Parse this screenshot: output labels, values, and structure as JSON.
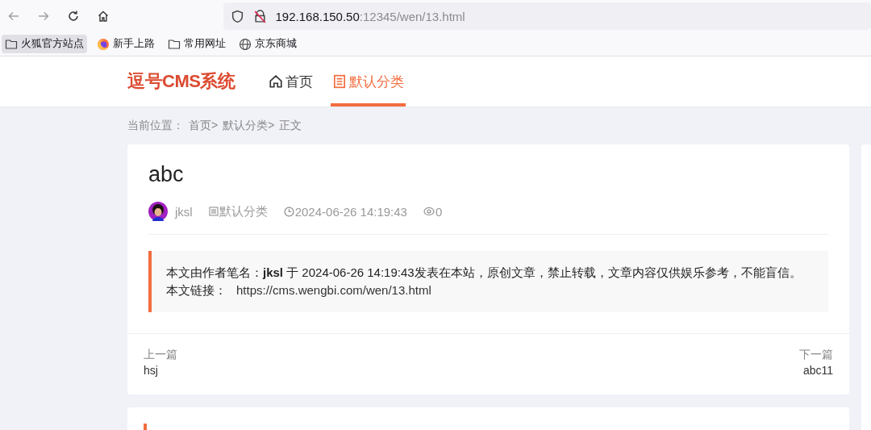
{
  "browser": {
    "url_host": "192.168.150.50",
    "url_rest": ":12345/wen/13.html",
    "bookmarks": [
      {
        "label": "火狐官方站点",
        "kind": "folder",
        "selected": true
      },
      {
        "label": "新手上路",
        "kind": "firefox",
        "selected": false
      },
      {
        "label": "常用网址",
        "kind": "folder",
        "selected": false
      },
      {
        "label": "京东商城",
        "kind": "globe",
        "selected": false
      }
    ]
  },
  "header": {
    "logo": "逗号CMS系统",
    "nav": [
      {
        "label": "首页",
        "kind": "home",
        "selected": false
      },
      {
        "label": "默认分类",
        "kind": "doc",
        "selected": true
      }
    ]
  },
  "breadcrumb": {
    "label": "当前位置：",
    "items": [
      "首页>",
      "默认分类>",
      "正文"
    ]
  },
  "article": {
    "title": "abc",
    "author": "jksl",
    "category": "默认分类",
    "date": "2024-06-26 14:19:43",
    "views": "0",
    "notice": {
      "text": "本文由作者笔名：**jksl** 于 2024-06-26 14:19:43发表在本站，原创文章，禁止转载，文章内容仅供娱乐参考，不能盲信。",
      "link_label": "本文链接：",
      "link": "https://cms.wengbi.com/wen/13.html"
    },
    "prev": {
      "label": "上一篇",
      "title": "hsj"
    },
    "next": {
      "label": "下一篇",
      "title": "abc11"
    }
  }
}
